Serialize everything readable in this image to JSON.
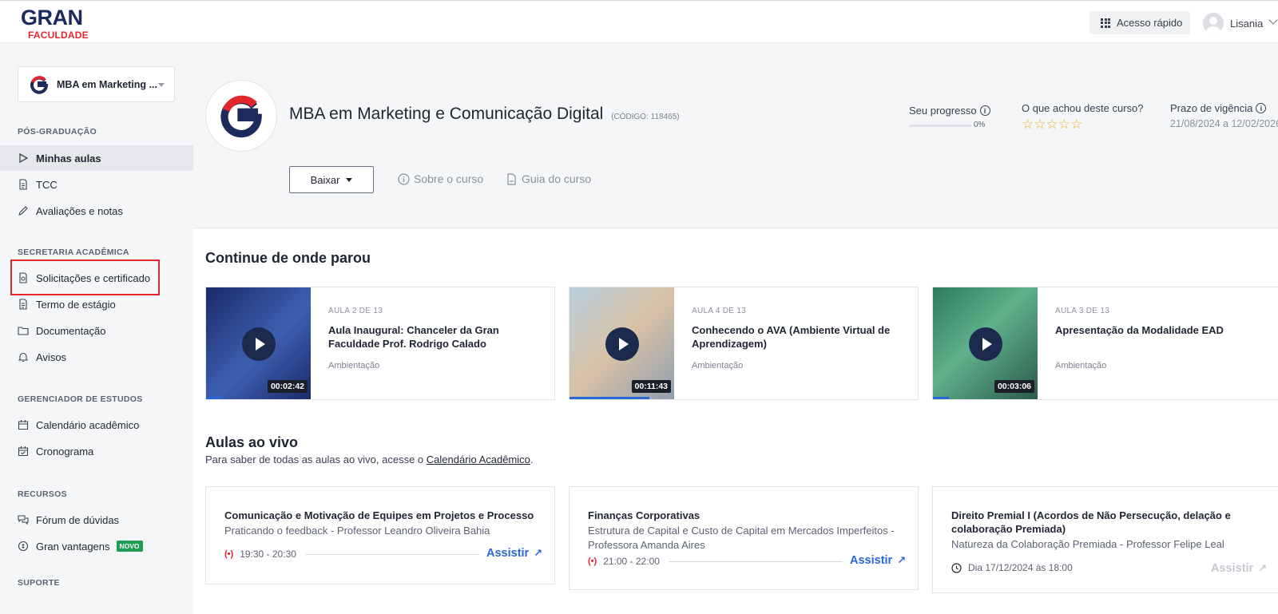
{
  "header": {
    "logo_top": "GRAN",
    "logo_bottom": "FACULDADE",
    "quick_access": "Acesso rápido",
    "user_name": "Lisania"
  },
  "sidebar": {
    "course_select": "MBA em Marketing ...",
    "sections": {
      "pos": "PÓS-GRADUAÇÃO",
      "secretaria": "SECRETARIA ACADÊMICA",
      "gerenciador": "GERENCIADOR DE ESTUDOS",
      "recursos": "RECURSOS",
      "suporte": "SUPORTE"
    },
    "items": {
      "minhas_aulas": "Minhas aulas",
      "tcc": "TCC",
      "avaliacoes": "Avaliações e notas",
      "solicitacoes": "Solicitações e certificado",
      "termo": "Termo de estágio",
      "documentacao": "Documentação",
      "avisos": "Avisos",
      "calendario": "Calendário acadêmico",
      "cronograma": "Cronograma",
      "forum": "Fórum de dúvidas",
      "vantagens": "Gran vantagens",
      "novo_badge": "NOVO"
    }
  },
  "course": {
    "title": "MBA em Marketing e Comunicação Digital",
    "code": "(CÓDIGO: 118465)",
    "download_button": "Baixar",
    "about_link": "Sobre o curso",
    "guide_link": "Guia do curso",
    "progress_label": "Seu progresso",
    "progress_value": "0%",
    "progress_fraction": 0,
    "rating_label": "O que achou deste curso?",
    "rating_stars": "☆☆☆☆☆",
    "validity_label": "Prazo de vigência",
    "validity_dates": "21/08/2024 a 12/02/2026"
  },
  "continue": {
    "title": "Continue de onde parou",
    "cards": [
      {
        "meta": "AULA 2 DE 13",
        "title": "Aula Inaugural: Chanceler da Gran Faculdade Prof. Rodrigo Calado",
        "category": "Ambientação",
        "duration": "00:02:42",
        "progress": 0.15,
        "thumb_color": "#2a3f8f"
      },
      {
        "meta": "AULA 4 DE 13",
        "title": "Conhecendo o AVA (Ambiente Virtual de Aprendizagem)",
        "category": "Ambientação",
        "duration": "00:11:43",
        "progress": 0.75,
        "thumb_color": "#a9c4d4"
      },
      {
        "meta": "AULA 3 DE 13",
        "title": "Apresentação da Modalidade EAD",
        "category": "Ambientação",
        "duration": "00:03:06",
        "progress": 0.15,
        "thumb_color": "#3f8a74"
      }
    ]
  },
  "live": {
    "title": "Aulas ao vivo",
    "subtitle_prefix": "Para saber de todas as aulas ao vivo, acesse o",
    "subtitle_link": "Calendário Acadêmico",
    "subtitle_suffix": ".",
    "live_icon": "(•)",
    "cards": [
      {
        "title": "Comunicação e Motivação de Equipes em Projetos e Processo",
        "subtitle": "Praticando o feedback - Professor Leandro Oliveira Bahia",
        "time": "19:30 - 20:30",
        "action": "Assistir"
      },
      {
        "title": "Finanças Corporativas",
        "subtitle": "Estrutura de Capital e Custo de Capital em Mercados Imperfeitos - Professora Amanda Aires",
        "time": "21:00 - 22:00",
        "action": "Assistir"
      },
      {
        "title": "Direito Premial I (Acordos de Não Persecução, delação e colaboração Premiada)",
        "subtitle": "Natureza da Colaboração Premiada - Professor Felipe Leal",
        "time": "Dia 17/12/2024 às 18:00",
        "action": "Assistir"
      }
    ]
  },
  "colors": {
    "brand_navy": "#1c2a5c",
    "brand_red": "#e3262d",
    "accent_blue": "#2a67d6",
    "star": "#f0a92a"
  }
}
